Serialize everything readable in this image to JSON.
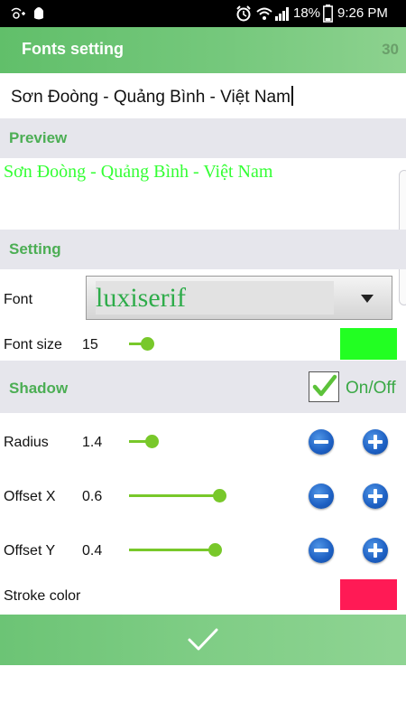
{
  "status_bar": {
    "battery": "18%",
    "time": "9:26 PM"
  },
  "header": {
    "title": "Fonts setting",
    "count": "30"
  },
  "text_input": {
    "value": "Sơn Đoòng - Quảng Bình - Việt Nam"
  },
  "preview": {
    "label": "Preview",
    "text": "Sơn Đoòng - Quảng Bình - Việt Nam",
    "color": "#33ff33"
  },
  "setting": {
    "label": "Setting",
    "font_label": "Font",
    "font_value": "luxiserif",
    "font_size_label": "Font size",
    "font_size_value": "15",
    "font_size_slider": 0.15,
    "font_color": "#22ff22"
  },
  "shadow": {
    "label": "Shadow",
    "toggle_label": "On/Off",
    "toggle_checked": true,
    "radius_label": "Radius",
    "radius_value": "1.4",
    "radius_slider": 0.2,
    "offset_x_label": "Offset X",
    "offset_x_value": "0.6",
    "offset_x_slider": 0.95,
    "offset_y_label": "Offset Y",
    "offset_y_value": "0.4",
    "offset_y_slider": 0.9,
    "stroke_color_label": "Stroke color",
    "stroke_color": "#ff1a55"
  },
  "icons": {
    "decrement": "minus-circle-icon",
    "increment": "plus-circle-icon",
    "confirm": "checkmark-icon"
  }
}
